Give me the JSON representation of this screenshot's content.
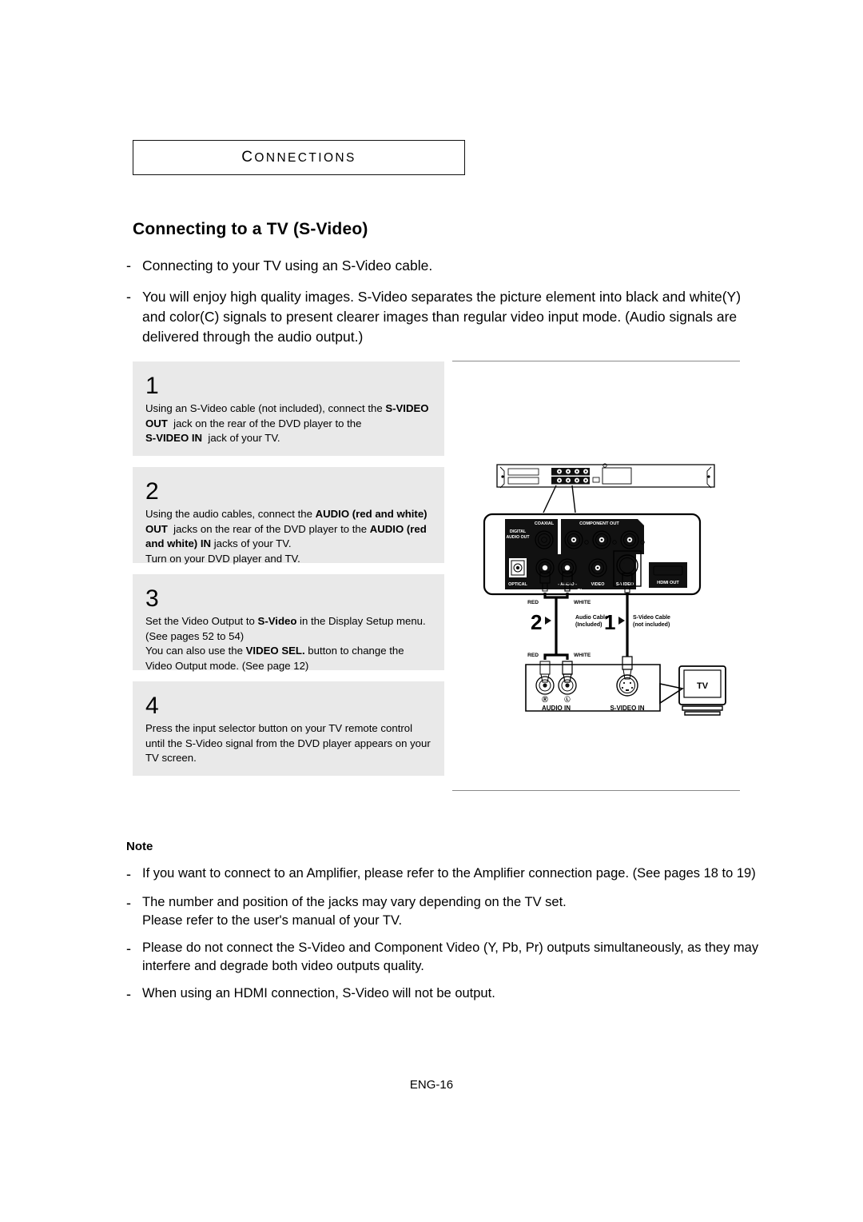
{
  "section": {
    "label": "Connections",
    "first_letter": "C",
    "rest": "ONNECTIONS"
  },
  "page_title": "Connecting to a TV (S-Video)",
  "intro_bullets": [
    "Connecting to your TV using an S-Video cable.",
    "You will enjoy high quality images. S-Video separates the picture element into black and white(Y) and color(C) signals to present clearer images than regular video input mode. (Audio signals are delivered through the audio output.)"
  ],
  "bullet_dash": "-",
  "steps": [
    {
      "number": "1",
      "html": "Using an S-Video cable (not included), connect the <b>S-VIDEO OUT</b>&nbsp; jack on the rear of the DVD player to the<br><b>S-VIDEO IN</b>&nbsp; jack of your TV."
    },
    {
      "number": "2",
      "html": "Using the audio cables, connect the <b>AUDIO (red and white) OUT</b>&nbsp; jacks on the rear of the DVD player to the <b>AUDIO (red and white) IN</b> jacks of your TV.<br>Turn on your DVD player and TV."
    },
    {
      "number": "3",
      "html": "Set the Video Output to <b>S-Video</b> in the Display Setup menu. (See pages 52 to 54)<br>You can also use the <b>VIDEO SEL.</b> button to change the Video Output mode. (See page 12)"
    },
    {
      "number": "4",
      "html": "Press the input selector button on your TV remote control until the S-Video signal from the DVD player appears on your TV screen."
    }
  ],
  "diagram": {
    "rear_panel_labels": {
      "digital_audio_out": "DIGITAL AUDIO OUT",
      "coaxial": "COAXIAL",
      "component_out": "COMPONENT OUT",
      "optical": "OPTICAL",
      "audio": "AUDIO",
      "out": "OUT",
      "video": "VIDEO",
      "s_video": "S-VIDEO",
      "hdmi_out": "HDMI OUT"
    },
    "cable_labels": {
      "red_top": "RED",
      "white_top": "WHITE",
      "red_bottom": "RED",
      "white_bottom": "WHITE",
      "audio_cable": "Audio Cable",
      "audio_cable_sub": "(Included)",
      "svideo_cable": "S-Video Cable",
      "svideo_cable_sub": "(not included)",
      "marker_audio": "2",
      "marker_svideo": "1"
    },
    "tv_panel_labels": {
      "audio_in": "AUDIO IN",
      "s_video_in": "S-VIDEO IN",
      "jack_right": "R",
      "jack_left": "L",
      "tv": "TV"
    }
  },
  "note": {
    "title": "Note",
    "items": [
      "If you want to connect to an Amplifier, please refer to the Amplifier connection page. (See pages 18 to 19)",
      "The number and position of the jacks may vary depending on the TV set.\nPlease refer to the user's manual of your TV.",
      "Please do not connect  the S-Video and Component Video (Y, Pb, Pr) outputs simultaneously, as they may interfere and degrade both video outputs quality.",
      "When using an HDMI connection, S-Video will not be output."
    ]
  },
  "footer": "ENG-16"
}
